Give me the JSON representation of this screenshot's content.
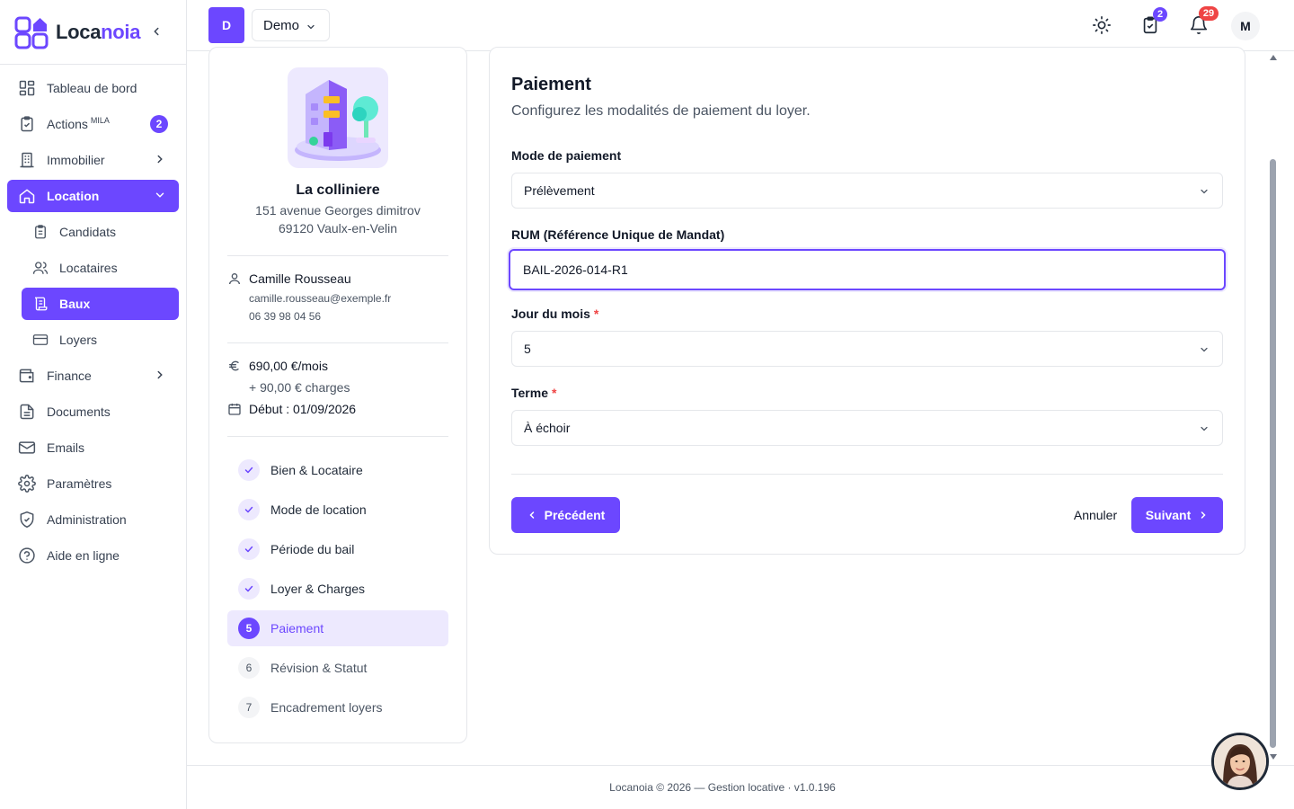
{
  "app": {
    "brand_a": "Loca",
    "brand_b": "noia",
    "brand_color": "#6c47ff"
  },
  "sidebar": {
    "items": [
      {
        "label": "Tableau de bord",
        "icon": "dashboard-icon"
      },
      {
        "label": "Actions",
        "sup": "MILA",
        "badge": "2",
        "icon": "clipboard-check-icon"
      },
      {
        "label": "Immobilier",
        "icon": "building-icon"
      },
      {
        "label": "Location",
        "icon": "home-icon"
      },
      {
        "label": "Candidats",
        "icon": "clipboard-list-icon"
      },
      {
        "label": "Locataires",
        "icon": "users-icon"
      },
      {
        "label": "Baux",
        "icon": "scroll-icon"
      },
      {
        "label": "Loyers",
        "icon": "credit-card-icon"
      },
      {
        "label": "Finance",
        "icon": "wallet-icon"
      },
      {
        "label": "Documents",
        "icon": "document-icon"
      },
      {
        "label": "Emails",
        "icon": "mail-icon"
      },
      {
        "label": "Paramètres",
        "icon": "gear-icon"
      },
      {
        "label": "Administration",
        "icon": "shield-check-icon"
      },
      {
        "label": "Aide en ligne",
        "icon": "help-circle-icon"
      }
    ]
  },
  "header": {
    "org_initial": "D",
    "org_name": "Demo",
    "tasks_count": "2",
    "notifications_count": "29",
    "user_initial": "M"
  },
  "summary": {
    "property_name": "La colliniere",
    "address_line1": "151 avenue Georges dimitrov",
    "address_line2": "69120 Vaulx-en-Velin",
    "tenant_name": "Camille Rousseau",
    "tenant_email": "camille.rousseau@exemple.fr",
    "tenant_phone": "06 39 98 04 56",
    "rent": "690,00 €/mois",
    "charges": "+ 90,00 € charges",
    "start": "Début : 01/09/2026",
    "steps": [
      {
        "num": "1",
        "label": "Bien & Locataire",
        "state": "done"
      },
      {
        "num": "2",
        "label": "Mode de location",
        "state": "done"
      },
      {
        "num": "3",
        "label": "Période du bail",
        "state": "done"
      },
      {
        "num": "4",
        "label": "Loyer & Charges",
        "state": "done"
      },
      {
        "num": "5",
        "label": "Paiement",
        "state": "active"
      },
      {
        "num": "6",
        "label": "Révision & Statut",
        "state": "todo"
      },
      {
        "num": "7",
        "label": "Encadrement loyers",
        "state": "todo"
      }
    ]
  },
  "form": {
    "title": "Paiement",
    "subtitle": "Configurez les modalités de paiement du loyer.",
    "payment_mode_label": "Mode de paiement",
    "payment_mode_value": "Prélèvement",
    "rum_label": "RUM (Référence Unique de Mandat)",
    "rum_value": "BAIL-2026-014-R1",
    "day_label": "Jour du mois",
    "day_value": "5",
    "term_label": "Terme",
    "term_value": "À échoir",
    "prev_label": "Précédent",
    "cancel_label": "Annuler",
    "next_label": "Suivant"
  },
  "footer": {
    "text": "Locanoia © 2026 — Gestion locative · v1.0.196"
  }
}
